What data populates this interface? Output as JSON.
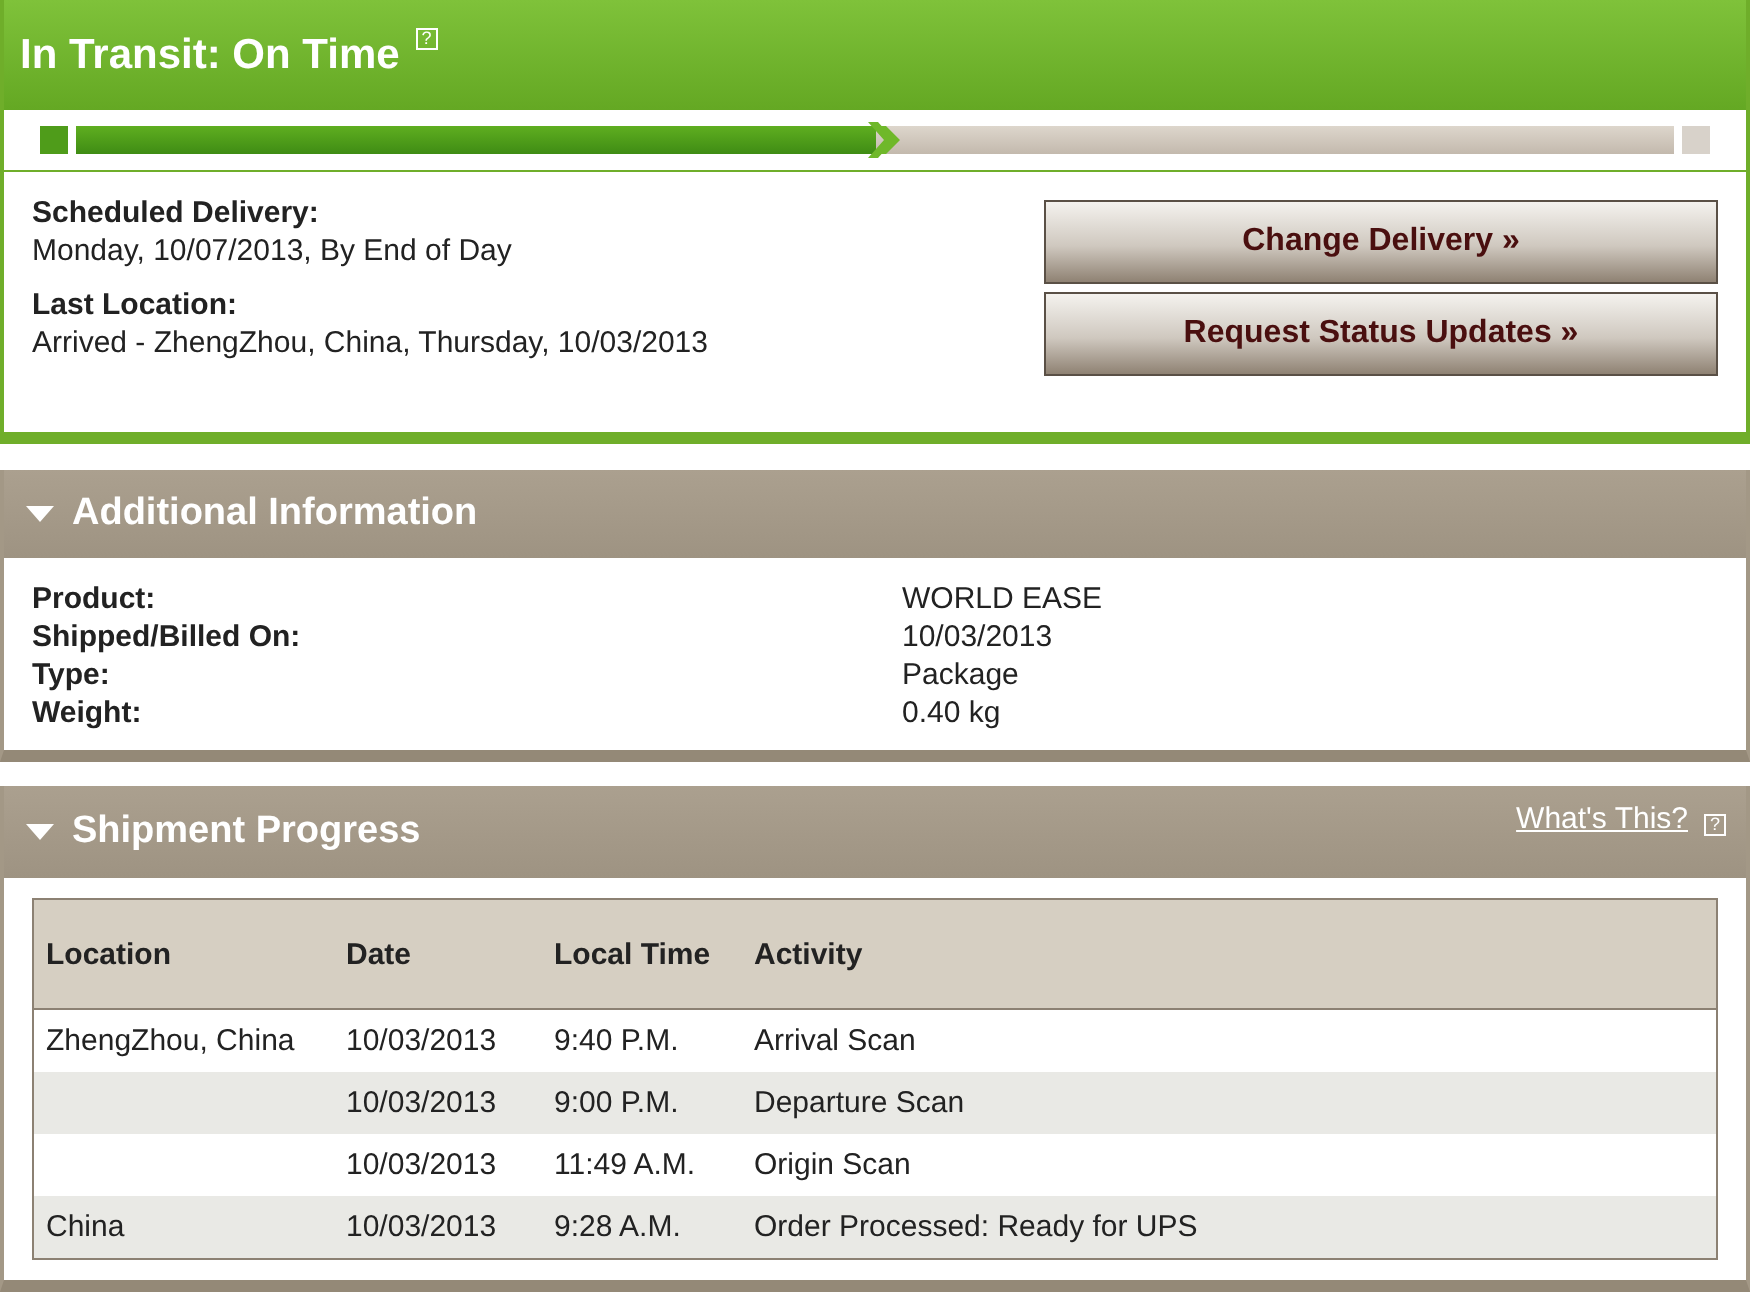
{
  "status": {
    "title": "In Transit: On Time",
    "help_mark": "?"
  },
  "progress": {
    "level": 0.5
  },
  "delivery": {
    "fields": [
      {
        "label": "Scheduled Delivery:",
        "value": "Monday, 10/07/2013, By End of Day"
      },
      {
        "label": "Last Location:",
        "value": "Arrived - ZhengZhou, China, Thursday, 10/03/2013"
      }
    ],
    "buttons": [
      "Change Delivery »",
      "Request Status Updates »"
    ]
  },
  "additional_information": {
    "title": "Additional Information",
    "expanded": true,
    "rows": [
      {
        "label": "Product:",
        "value": "WORLD EASE"
      },
      {
        "label": "Shipped/Billed On:",
        "value": "10/03/2013"
      },
      {
        "label": "Type:",
        "value": "Package"
      },
      {
        "label": "Weight:",
        "value": "0.40 kg"
      }
    ]
  },
  "shipment_progress": {
    "title": "Shipment Progress",
    "expanded": true,
    "help_link": "What's This?",
    "help_mark": "?",
    "table": {
      "columns": [
        "Location",
        "Date",
        "Local Time",
        "Activity"
      ],
      "rows": [
        [
          "ZhengZhou, China",
          "10/03/2013",
          "9:40 P.M.",
          "Arrival Scan"
        ],
        [
          "",
          "10/03/2013",
          "9:00 P.M.",
          "Departure Scan"
        ],
        [
          "",
          "10/03/2013",
          "11:49 A.M.",
          "Origin Scan"
        ],
        [
          "China",
          "10/03/2013",
          "9:28 A.M.",
          "Order Processed: Ready for UPS"
        ]
      ]
    }
  }
}
